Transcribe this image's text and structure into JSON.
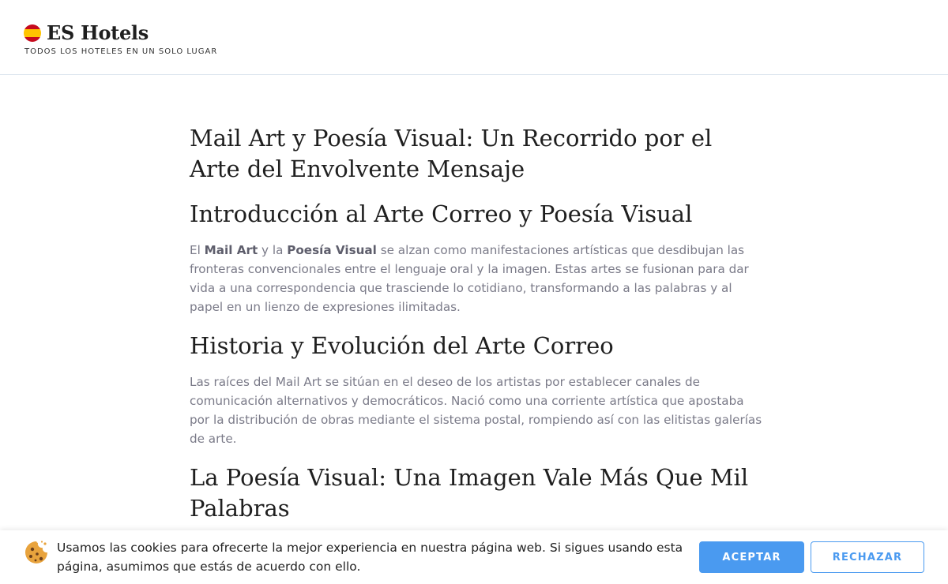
{
  "header": {
    "site_title": "ES Hotels",
    "tagline": "TODOS LOS HOTELES EN UN SOLO LUGAR",
    "flag_icon": "spain-flag-icon"
  },
  "article": {
    "title": "Mail Art y Poesía Visual: Un Recorrido por el Arte del Envolvente Mensaje",
    "sections": [
      {
        "heading": "Introducción al Arte Correo y Poesía Visual",
        "p_pre": "El ",
        "p_bold1": "Mail Art",
        "p_mid": " y la ",
        "p_bold2": "Poesía Visual",
        "p_post": " se alzan como manifestaciones artísticas que desdibujan las fronteras convencionales entre el lenguaje oral y la imagen. Estas artes se fusionan para dar vida a una correspondencia que trasciende lo cotidiano, transformando a las palabras y al papel en un lienzo de expresiones ilimitadas."
      },
      {
        "heading": "Historia y Evolución del Arte Correo",
        "paragraph": "Las raíces del Mail Art se sitúan en el deseo de los artistas por establecer canales de comunicación alternativos y democráticos. Nació como una corriente artística que apostaba por la distribución de obras mediante el sistema postal, rompiendo así con las elitistas galerías de arte."
      },
      {
        "heading": "La Poesía Visual: Una Imagen Vale Más Que Mil Palabras"
      }
    ]
  },
  "cookie_banner": {
    "icon": "cookie-icon",
    "text": "Usamos las cookies para ofrecerte la mejor experiencia en nuestra página web. Si sigues usando esta página, asumimos que estás de acuerdo con ello.",
    "accept_label": "ACEPTAR",
    "reject_label": "RECHAZAR"
  },
  "colors": {
    "accent": "#4a9af0",
    "heading": "#1f1f1f",
    "body_text": "#7a7a88"
  }
}
